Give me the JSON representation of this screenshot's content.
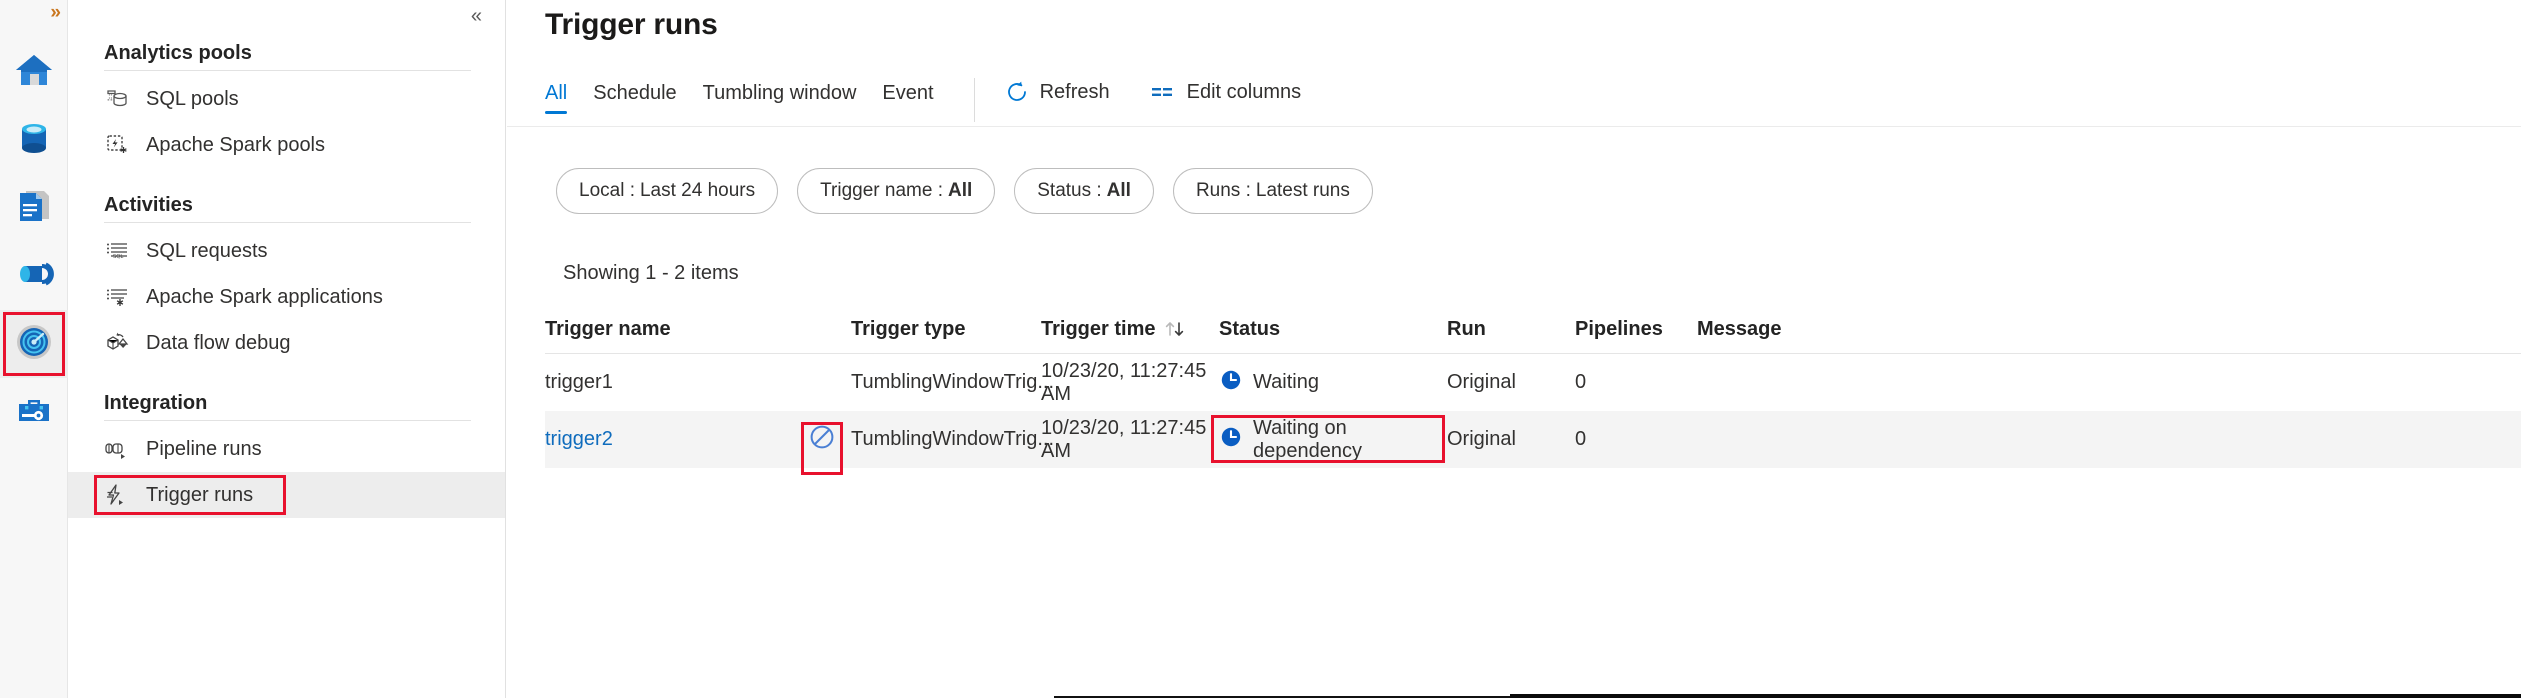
{
  "rail": {
    "expand_label": "»",
    "items": [
      {
        "name": "home-icon",
        "label": "Home",
        "selected": false
      },
      {
        "name": "data-icon",
        "label": "Data",
        "selected": false
      },
      {
        "name": "develop-icon",
        "label": "Develop",
        "selected": false
      },
      {
        "name": "integrate-icon",
        "label": "Integrate",
        "selected": false
      },
      {
        "name": "monitor-icon",
        "label": "Monitor",
        "selected": true
      },
      {
        "name": "manage-icon",
        "label": "Manage",
        "selected": false
      }
    ]
  },
  "sidebar": {
    "collapse_label": "«",
    "groups": [
      {
        "title": "Analytics pools",
        "items": [
          {
            "label": "SQL pools",
            "icon": "sql-pools-icon",
            "selected": false
          },
          {
            "label": "Apache Spark pools",
            "icon": "spark-pools-icon",
            "selected": false
          }
        ]
      },
      {
        "title": "Activities",
        "items": [
          {
            "label": "SQL requests",
            "icon": "sql-requests-icon",
            "selected": false
          },
          {
            "label": "Apache Spark applications",
            "icon": "spark-apps-icon",
            "selected": false
          },
          {
            "label": "Data flow debug",
            "icon": "data-flow-debug-icon",
            "selected": false
          }
        ]
      },
      {
        "title": "Integration",
        "items": [
          {
            "label": "Pipeline runs",
            "icon": "pipeline-runs-icon",
            "selected": false
          },
          {
            "label": "Trigger runs",
            "icon": "trigger-runs-icon",
            "selected": true
          }
        ]
      }
    ]
  },
  "main": {
    "page_title": "Trigger runs",
    "tabs": [
      {
        "label": "All",
        "active": true
      },
      {
        "label": "Schedule",
        "active": false
      },
      {
        "label": "Tumbling window",
        "active": false
      },
      {
        "label": "Event",
        "active": false
      }
    ],
    "commands": [
      {
        "label": "Refresh",
        "icon": "refresh-icon"
      },
      {
        "label": "Edit columns",
        "icon": "edit-columns-icon"
      }
    ],
    "filters": [
      {
        "label": "Local :",
        "value": "Last 24 hours",
        "bold": false
      },
      {
        "label": "Trigger name :",
        "value": "All",
        "bold": true
      },
      {
        "label": "Status :",
        "value": "All",
        "bold": true
      },
      {
        "label": "Runs :",
        "value": "Latest runs",
        "bold": false
      }
    ],
    "showing": "Showing 1 - 2 items",
    "table": {
      "columns": [
        {
          "key": "trigger_name",
          "label": "Trigger name"
        },
        {
          "key": "action",
          "label": ""
        },
        {
          "key": "trigger_type",
          "label": "Trigger type"
        },
        {
          "key": "trigger_time",
          "label": "Trigger time",
          "sort": "↑↓"
        },
        {
          "key": "status",
          "label": "Status"
        },
        {
          "key": "run",
          "label": "Run"
        },
        {
          "key": "pipelines",
          "label": "Pipelines"
        },
        {
          "key": "message",
          "label": "Message"
        }
      ],
      "rows": [
        {
          "trigger_name": "trigger1",
          "is_link": false,
          "action_icon": "",
          "trigger_type": "TumblingWindowTrig...",
          "trigger_time": "10/23/20, 11:27:45 AM",
          "status_icon": "clock-icon",
          "status": "Waiting",
          "run": "Original",
          "pipelines": "0",
          "message": ""
        },
        {
          "trigger_name": "trigger2",
          "is_link": true,
          "action_icon": "cancel-icon",
          "trigger_type": "TumblingWindowTrig...",
          "trigger_time": "10/23/20, 11:27:45 AM",
          "status_icon": "clock-icon",
          "status": "Waiting on dependency",
          "run": "Original",
          "pipelines": "0",
          "message": ""
        }
      ]
    }
  },
  "colors": {
    "accent": "#0078d4",
    "link": "#0f6cbd",
    "highlight": "#e8112d",
    "status_clock": "#0a5dc2",
    "cancel_icon": "#4a7fd4",
    "row_alt": "#f4f4f4"
  }
}
